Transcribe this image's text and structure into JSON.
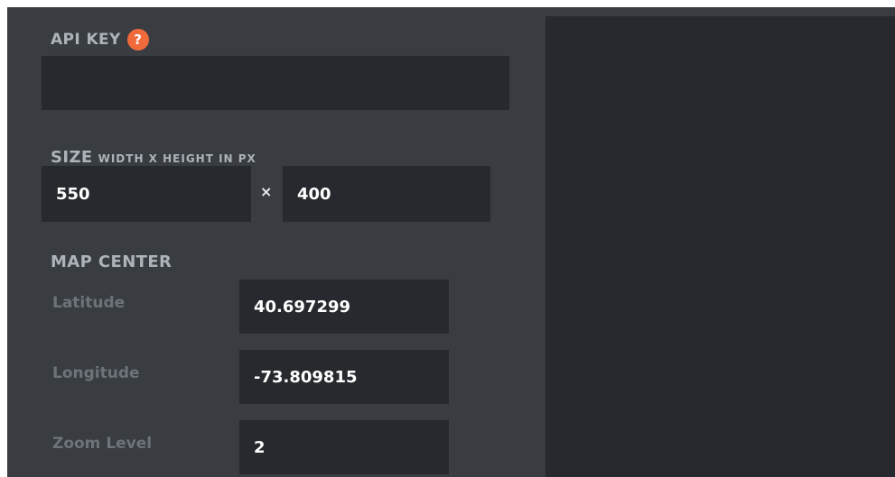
{
  "api_key": {
    "label": "API KEY",
    "help_icon": "question-mark",
    "value": ""
  },
  "size": {
    "label": "SIZE",
    "sublabel": "WIDTH X HEIGHT IN PX",
    "width": "550",
    "separator": "×",
    "height": "400"
  },
  "map_center": {
    "label": "MAP CENTER",
    "latitude_label": "Latitude",
    "latitude": "40.697299",
    "longitude_label": "Longitude",
    "longitude": "-73.809815",
    "zoom_label": "Zoom Level",
    "zoom": "2"
  },
  "colors": {
    "panel_bg": "#393d42",
    "field_bg": "#26292d",
    "accent": "#f06a3c",
    "label": "#aeb3b9",
    "muted_label": "#6d7379"
  }
}
